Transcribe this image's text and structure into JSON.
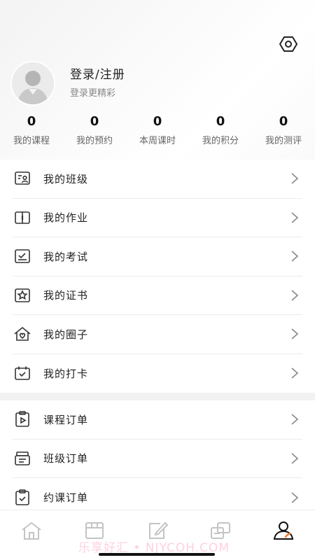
{
  "profile": {
    "title": "登录/注册",
    "subtitle": "登录更精彩"
  },
  "stats": [
    {
      "value": "0",
      "label": "我的课程"
    },
    {
      "value": "0",
      "label": "我的预约"
    },
    {
      "value": "0",
      "label": "本周课时"
    },
    {
      "value": "0",
      "label": "我的积分"
    },
    {
      "value": "0",
      "label": "我的测评"
    }
  ],
  "menu_group_1": [
    {
      "label": "我的班级",
      "icon": "class-icon"
    },
    {
      "label": "我的作业",
      "icon": "homework-icon"
    },
    {
      "label": "我的考试",
      "icon": "exam-icon"
    },
    {
      "label": "我的证书",
      "icon": "certificate-icon"
    },
    {
      "label": "我的圈子",
      "icon": "circle-icon"
    },
    {
      "label": "我的打卡",
      "icon": "checkin-icon"
    }
  ],
  "menu_group_2": [
    {
      "label": "课程订单",
      "icon": "course-order-icon"
    },
    {
      "label": "班级订单",
      "icon": "class-order-icon"
    },
    {
      "label": "约课订单",
      "icon": "booking-order-icon"
    }
  ],
  "tabbar": [
    {
      "icon": "home-icon",
      "active": false
    },
    {
      "icon": "catalog-icon",
      "active": false
    },
    {
      "icon": "edit-icon",
      "active": false
    },
    {
      "icon": "community-icon",
      "active": false
    },
    {
      "icon": "profile-icon",
      "active": true
    }
  ],
  "watermark": "乐享好汇 • NJYCOH.COM",
  "colors": {
    "accent": "#f07a2f",
    "icon": "#333333",
    "tab_inactive": "#c4c4c4"
  }
}
